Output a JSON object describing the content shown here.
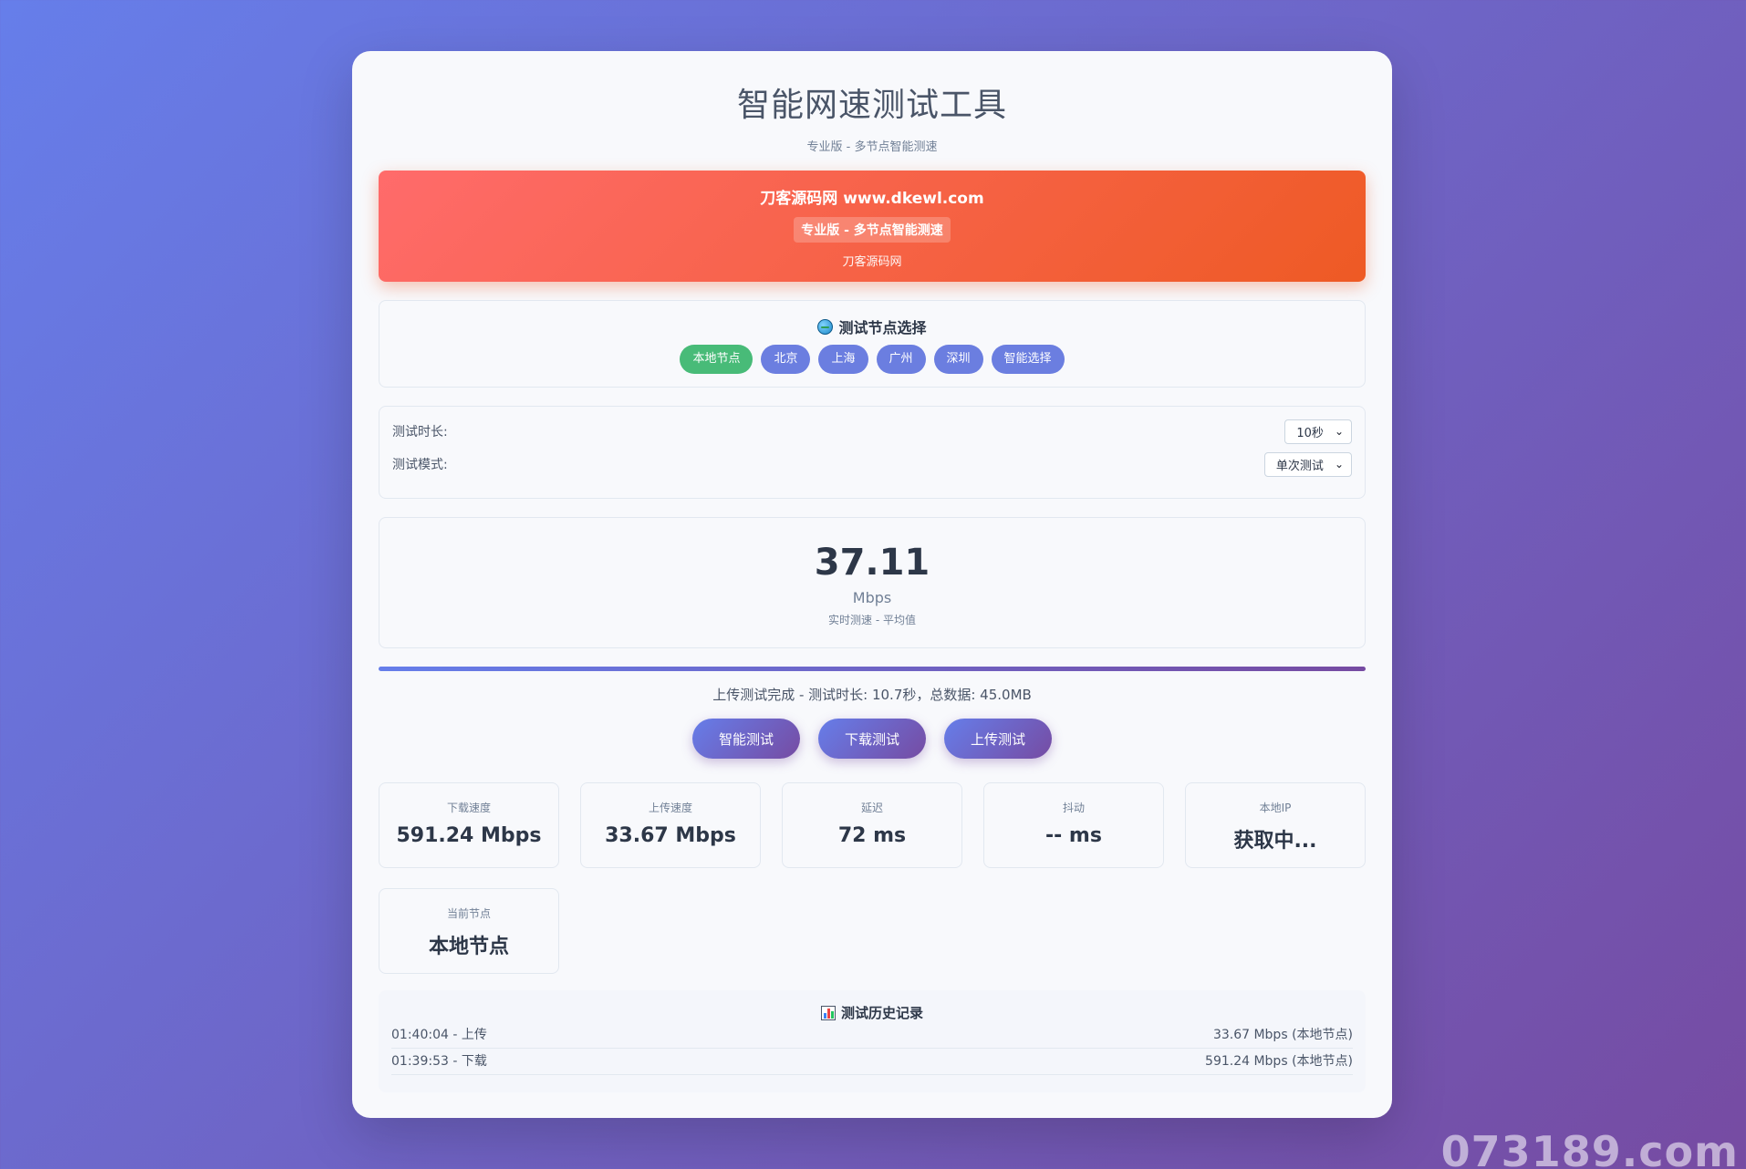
{
  "header": {
    "title": "智能网速测试工具",
    "subtitle": "专业版 - 多节点智能测速"
  },
  "banner": {
    "title": "刀客源码网 www.dkewl.com",
    "tag": "专业版 - 多节点智能测速",
    "footer": "刀客源码网"
  },
  "nodes": {
    "title": "测试节点选择",
    "title_icon": "globe-icon",
    "items": [
      "本地节点",
      "北京",
      "上海",
      "广州",
      "深圳",
      "智能选择"
    ],
    "active_index": 0
  },
  "settings": {
    "duration_label": "测试时长:",
    "duration_value": "10秒",
    "mode_label": "测试模式:",
    "mode_value": "单次测试"
  },
  "speed": {
    "value": "37.11",
    "unit": "Mbps",
    "label": "实时测速 - 平均值"
  },
  "progress": {
    "percent": 100
  },
  "status": "上传测试完成 - 测试时长: 10.7秒，总数据: 45.0MB",
  "actions": {
    "smart": "智能测试",
    "download": "下载测试",
    "upload": "上传测试"
  },
  "stats": [
    {
      "label": "下载速度",
      "value": "591.24 Mbps"
    },
    {
      "label": "上传速度",
      "value": "33.67 Mbps"
    },
    {
      "label": "延迟",
      "value": "72 ms"
    },
    {
      "label": "抖动",
      "value": "-- ms"
    },
    {
      "label": "本地IP",
      "value": "获取中..."
    },
    {
      "label": "当前节点",
      "value": "本地节点"
    }
  ],
  "history": {
    "title": "测试历史记录",
    "title_icon": "bar-chart-icon",
    "rows": [
      {
        "left": "01:40:04 - 上传",
        "right": "33.67 Mbps (本地节点)"
      },
      {
        "left": "01:39:53 - 下载",
        "right": "591.24 Mbps (本地节点)"
      }
    ]
  },
  "colors": {
    "bg_gradient_start": "#667eea",
    "bg_gradient_end": "#764ba2",
    "banner_start": "#ff6b6b",
    "banner_end": "#ee5a24",
    "active_node": "#48bb78",
    "node": "#6b7ee0"
  },
  "watermark": "073189.com"
}
